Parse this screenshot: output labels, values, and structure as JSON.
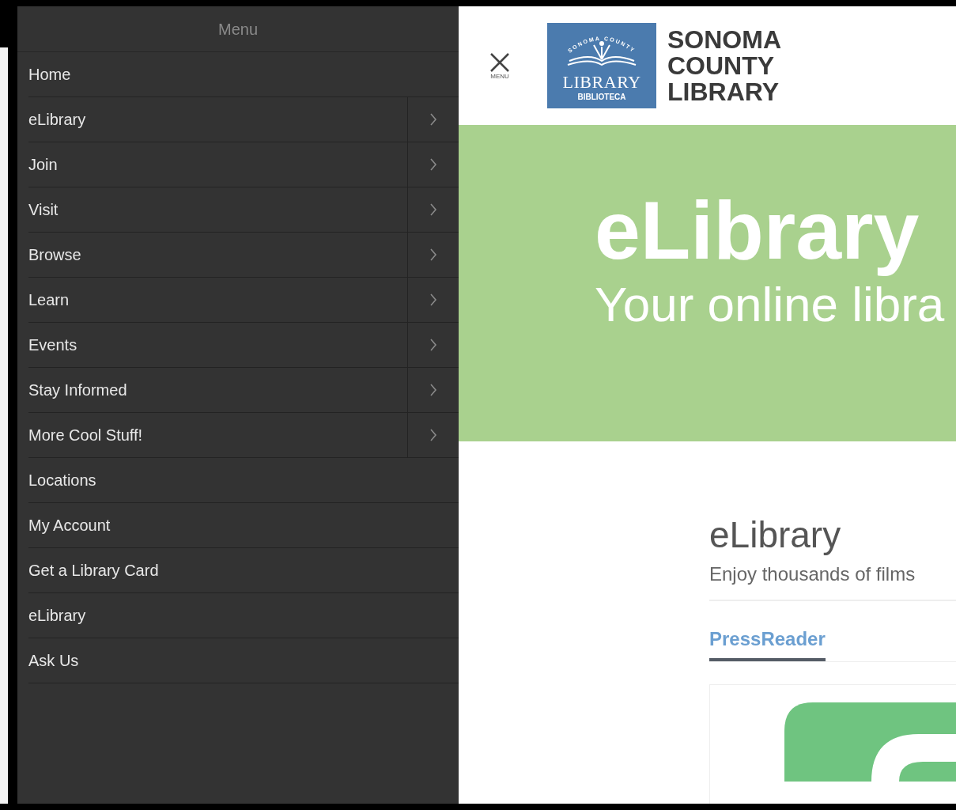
{
  "menu": {
    "title": "Menu",
    "items": [
      {
        "label": "Home",
        "has_submenu": false
      },
      {
        "label": "eLibrary",
        "has_submenu": true
      },
      {
        "label": "Join",
        "has_submenu": true
      },
      {
        "label": "Visit",
        "has_submenu": true
      },
      {
        "label": "Browse",
        "has_submenu": true
      },
      {
        "label": "Learn",
        "has_submenu": true
      },
      {
        "label": "Events",
        "has_submenu": true
      },
      {
        "label": "Stay Informed",
        "has_submenu": true
      },
      {
        "label": "More Cool Stuff!",
        "has_submenu": true
      },
      {
        "label": "Locations",
        "has_submenu": false
      },
      {
        "label": "My Account",
        "has_submenu": false
      },
      {
        "label": "Get a Library Card",
        "has_submenu": false
      },
      {
        "label": "eLibrary",
        "has_submenu": false
      },
      {
        "label": "Ask Us",
        "has_submenu": false
      }
    ]
  },
  "header": {
    "close_label": "MENU",
    "logo": {
      "arc_text": "SONOMA COUNTY",
      "main": "LIBRARY",
      "sub": "BIBLIOTECA"
    },
    "site_name": [
      "SONOMA",
      "COUNTY",
      "LIBRARY"
    ]
  },
  "banner": {
    "title": "eLibrary",
    "subtitle": "Your online libra"
  },
  "content": {
    "heading": "eLibrary",
    "intro": "Enjoy thousands of films",
    "tabs": [
      {
        "label": "PressReader",
        "selected": true
      }
    ]
  }
}
